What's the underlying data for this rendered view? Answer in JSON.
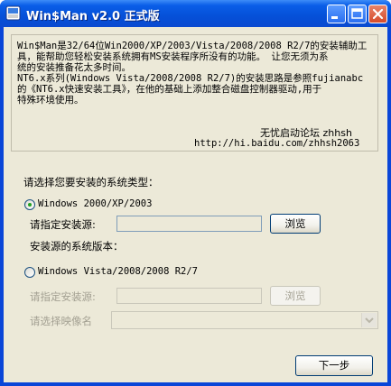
{
  "window": {
    "title": "Win$Man v2.0 正式版"
  },
  "info": {
    "lines": [
      "Win$Man是32/64位Win2000/XP/2003/Vista/2008/2008 R2/7的安装辅助工",
      "具，能帮助您轻松安装系统拥有MS安装程序所没有的功能。 让您无须为系",
      "统的安装推备花太多时间。",
      "NT6.x系列(Windows Vista/2008/2008 R2/7)的安装思路是参照fujianabc",
      "的《NT6.x快速安装工具》，在他的基础上添加整合磁盘控制器驱动,用于",
      "特殊环境使用。"
    ],
    "signature_name": "无忧启动论坛 zhhsh",
    "signature_url": "http://hi.baidu.com/zhhsh2063"
  },
  "form": {
    "prompt": "请选择您要安装的系统类型：",
    "option1": {
      "label": "Windows 2000/XP/2003",
      "selected": true,
      "source_label": "请指定安装源:",
      "source_value": "",
      "browse_label": "浏览",
      "version_label": "安装源的系统版本："
    },
    "option2": {
      "label": "Windows Vista/2008/2008 R2/7",
      "selected": false,
      "source_label": "请指定安装源:",
      "source_value": "",
      "browse_label": "浏览",
      "image_label": "请选择映像名",
      "image_value": ""
    },
    "next_label": "下一步"
  }
}
